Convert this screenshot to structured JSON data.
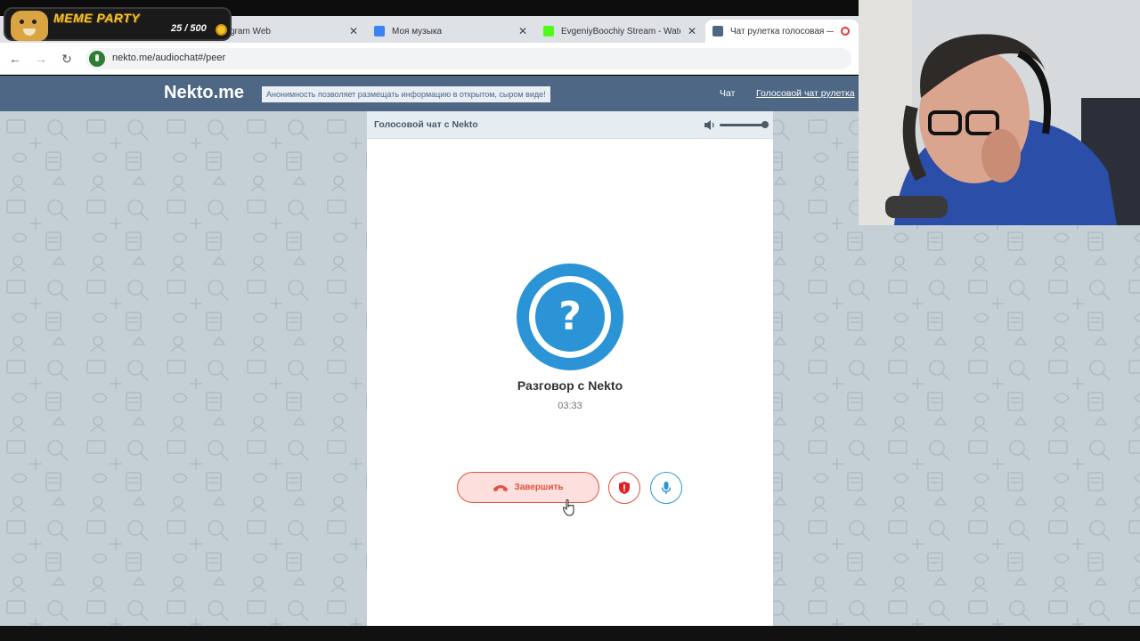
{
  "browser": {
    "tabs": [
      {
        "label": "gram Web",
        "favicon": "telegram-icon",
        "color": "#2aabee"
      },
      {
        "label": "Моя музыка",
        "favicon": "music-icon",
        "color": "#3b82f6"
      },
      {
        "label": "EvgeniyBoochiy Stream - Watch",
        "favicon": "kick-icon",
        "color": "#53fc18"
      },
      {
        "label": "Чат рулетка голосовая — ",
        "favicon": "nekto-icon",
        "color": "#4d6784"
      }
    ],
    "url": "nekto.me/audiochat#/peer"
  },
  "overlay": {
    "title": "MEME PARTY",
    "score": "25 / 500"
  },
  "site": {
    "logo": "Nekto.me",
    "tagline": "Анонимность позволяет размещать информацию в открытом, сыром виде!",
    "nav": {
      "chat": "Чат",
      "voice_chat": "Голосовой чат рулетка"
    }
  },
  "chat": {
    "header_title": "Голосовой чат с Nekto",
    "volume": 1.0,
    "avatar_symbol": "?",
    "conversation_title": "Разговор с Nekto",
    "timer": "03:33",
    "end_label": "Завершить"
  },
  "colors": {
    "header": "#4d6784",
    "accent_blue": "#2b94d6",
    "end_red": "#e0513f",
    "pattern_bg": "#c5d0d6"
  }
}
